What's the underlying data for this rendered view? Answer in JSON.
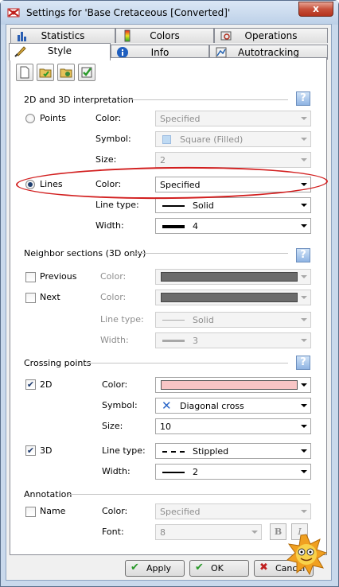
{
  "window": {
    "title": "Settings for 'Base Cretaceous [Converted]'",
    "close": "x"
  },
  "tabs_row1": [
    {
      "label": "Statistics",
      "icon": "bar-chart-icon"
    },
    {
      "label": "Colors",
      "icon": "color-bar-icon"
    },
    {
      "label": "Operations",
      "icon": "operations-icon"
    }
  ],
  "tabs_row2": [
    {
      "label": "Style",
      "icon": "brush-icon",
      "active": true
    },
    {
      "label": "Info",
      "icon": "info-icon"
    },
    {
      "label": "Autotracking",
      "icon": "autotracking-icon"
    }
  ],
  "sections": {
    "interp": {
      "title": "2D and 3D interpretation"
    },
    "neighbor": {
      "title": "Neighbor sections (3D only)"
    },
    "crossing": {
      "title": "Crossing points"
    },
    "annotation": {
      "title": "Annotation"
    }
  },
  "help": "?",
  "points": {
    "label": "Points",
    "color_label": "Color:",
    "color": "Specified",
    "symbol_label": "Symbol:",
    "symbol": "Square (Filled)",
    "size_label": "Size:",
    "size": "2"
  },
  "lines": {
    "label": "Lines",
    "color_label": "Color:",
    "color": "Specified",
    "linetype_label": "Line type:",
    "linetype": "Solid",
    "width_label": "Width:",
    "width": "4"
  },
  "previous": {
    "label": "Previous",
    "color_label": "Color:"
  },
  "next": {
    "label": "Next",
    "color_label": "Color:",
    "linetype_label": "Line type:",
    "linetype": "Solid",
    "width_label": "Width:",
    "width": "3"
  },
  "crossing2d": {
    "label": "2D",
    "color_label": "Color:",
    "color_hex": "#f8c5c5",
    "symbol_label": "Symbol:",
    "symbol": "Diagonal cross",
    "size_label": "Size:",
    "size": "10"
  },
  "crossing3d": {
    "label": "3D",
    "linetype_label": "Line type:",
    "linetype": "Stippled",
    "width_label": "Width:",
    "width": "2"
  },
  "annotation": {
    "label": "Name",
    "color_label": "Color:",
    "color": "Specified",
    "font_label": "Font:",
    "font": "8",
    "bold": "B",
    "italic": "I"
  },
  "buttons": {
    "apply": "Apply",
    "ok": "OK",
    "cancel": "Cancel"
  },
  "colors": {
    "accent_red": "#d21f1f",
    "neighbor_color": "#6b6b6b",
    "crossing_color": "#f8c5c5"
  }
}
